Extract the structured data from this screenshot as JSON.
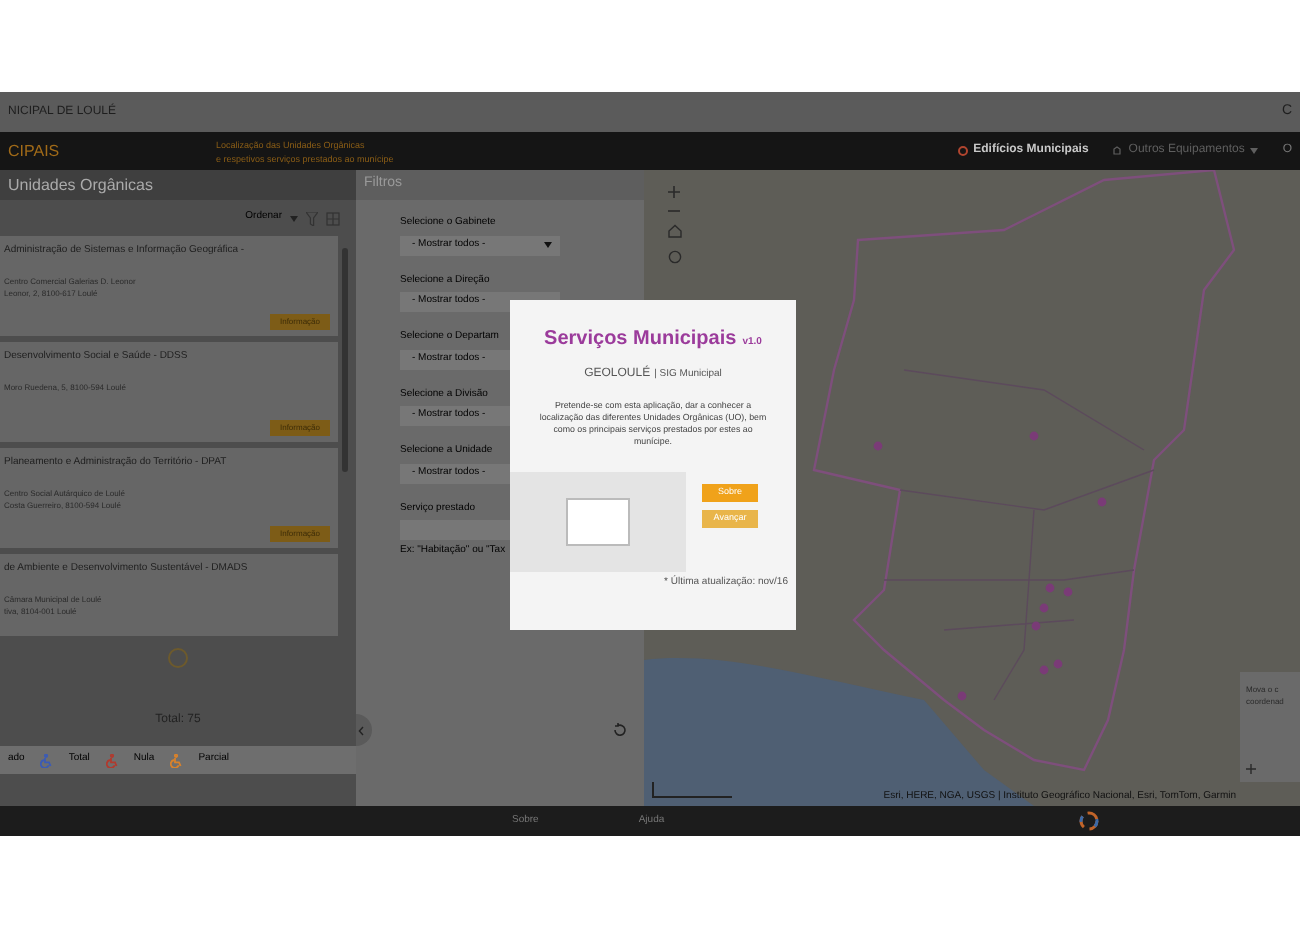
{
  "title_bar": {
    "title": "NICIPAL DE LOULÉ",
    "right_text": "C"
  },
  "header": {
    "app_name": "CIPAIS",
    "subtitle": [
      "Localização das Unidades Orgânicas",
      "e respetivos serviços prestados ao munícipe"
    ],
    "menu": [
      {
        "label": "Edifícios Municipais",
        "selected": true
      },
      {
        "label": "Outros Equipamentos",
        "selected": false
      }
    ],
    "right_text": "O"
  },
  "list_panel": {
    "title": "Unidades Orgânicas",
    "sort_label": "Ordenar",
    "items": [
      {
        "name": "Administração de Sistemas e Informação Geográfica -",
        "lines": [
          "Centro Comercial Galerias D. Leonor",
          "Leonor, 2, 8100-617 Loulé"
        ],
        "badge": "Informação"
      },
      {
        "name": "Desenvolvimento Social e Saúde - DDSS",
        "lines": [
          "Moro Ruedena, 5, 8100-594 Loulé"
        ],
        "badge": "Informação"
      },
      {
        "name": "Planeamento e Administração do Território - DPAT",
        "lines": [
          "Centro Social Autárquico de Loulé",
          "Costa Guerreiro, 8100-594 Loulé"
        ],
        "badge": "Informação"
      },
      {
        "name": "de Ambiente e Desenvolvimento Sustentável - DMADS",
        "lines": [
          "Câmara Municipal de Loulé",
          "tiva, 8104-001 Loulé"
        ]
      }
    ],
    "total": "Total: 75",
    "legend_prefix": "ado",
    "legend": [
      {
        "label": "Total",
        "color": "#3b5bb5"
      },
      {
        "label": "Nula",
        "color": "#b03a2e"
      },
      {
        "label": "Parcial",
        "color": "#d9822b"
      }
    ]
  },
  "filters": {
    "title": "Filtros",
    "selects": [
      {
        "label": "Selecione o Gabinete",
        "value": "- Mostrar todos -"
      },
      {
        "label": "Selecione a Direção",
        "value": "- Mostrar todos -"
      },
      {
        "label": "Selecione o Departam",
        "value": "- Mostrar todos -"
      },
      {
        "label": "Selecione a Divisão",
        "value": "- Mostrar todos -"
      },
      {
        "label": "Selecione a Unidade",
        "value": "- Mostrar todos -"
      }
    ],
    "service": {
      "label": "Serviço prestado",
      "hint": "Ex: \"Habitação\" ou \"Tax"
    }
  },
  "map": {
    "coords_box": [
      "Mova o c",
      "coordenad"
    ],
    "attribution": "Esri, HERE, NGA, USGS | Instituto Geográfico Nacional, Esri, TomTom, Garmin"
  },
  "modal": {
    "title": "Serviços Municipais",
    "version": "v1.0",
    "logo": "GEOLOULÉ",
    "logo_suffix": "| SIG Municipal",
    "text": "Pretende-se com esta aplicação, dar a conhecer a localização das diferentes Unidades Orgânicas (UO), bem como os principais serviços prestados por estes ao munícipe.",
    "buttons": [
      "Sobre",
      "Avançar"
    ],
    "note": "* Última atualização: nov/16"
  },
  "footer": {
    "links": [
      "Sobre",
      "Ajuda"
    ]
  }
}
